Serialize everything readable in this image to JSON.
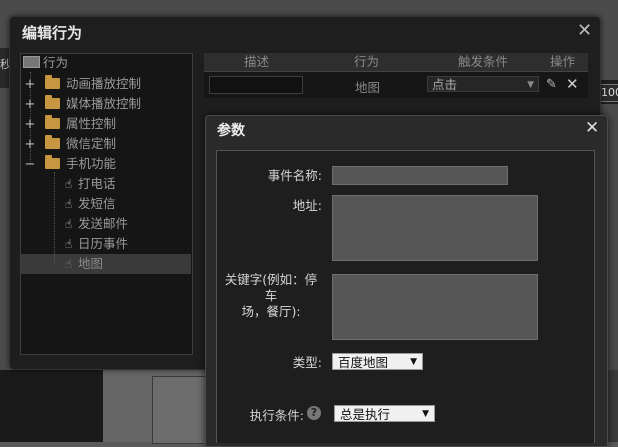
{
  "background": {
    "left_number": "秒",
    "right_number": "100"
  },
  "outer_dialog": {
    "title": "编辑行为",
    "close_glyph": "✕",
    "tree": {
      "root": "行为",
      "items": [
        {
          "label": "动画播放控制",
          "expander": "+"
        },
        {
          "label": "媒体播放控制",
          "expander": "+"
        },
        {
          "label": "属性控制",
          "expander": "+"
        },
        {
          "label": "微信定制",
          "expander": "+"
        },
        {
          "label": "手机功能",
          "expander": "−"
        }
      ],
      "children": [
        {
          "label": "打电话"
        },
        {
          "label": "发短信"
        },
        {
          "label": "发送邮件"
        },
        {
          "label": "日历事件"
        },
        {
          "label": "地图",
          "selected": true
        }
      ]
    },
    "table": {
      "columns": [
        "描述",
        "行为",
        "触发条件",
        "操作"
      ],
      "row": {
        "description": "",
        "action": "地图",
        "trigger": "点击"
      }
    }
  },
  "params_dialog": {
    "title": "参数",
    "close_glyph": "✕",
    "fields": {
      "event_name_label": "事件名称:",
      "event_name_value": "",
      "address_label": "地址:",
      "address_value": "",
      "keyword_label_line1": "关键字(例如：停车",
      "keyword_label_line2": "场，餐厅):",
      "keyword_value": "",
      "type_label": "类型:",
      "type_value": "百度地图",
      "condition_label": "执行条件:",
      "condition_value": "总是执行",
      "help_glyph": "?"
    }
  },
  "icons": {
    "folder": "folder-icon",
    "hand": "hand-pointer-icon",
    "pencil": "pencil-icon",
    "delete": "delete-icon"
  },
  "colors": {
    "folder": "#c79640",
    "dialog_bg": "#1e1e1e",
    "select_bg": "#f0f0f0"
  }
}
